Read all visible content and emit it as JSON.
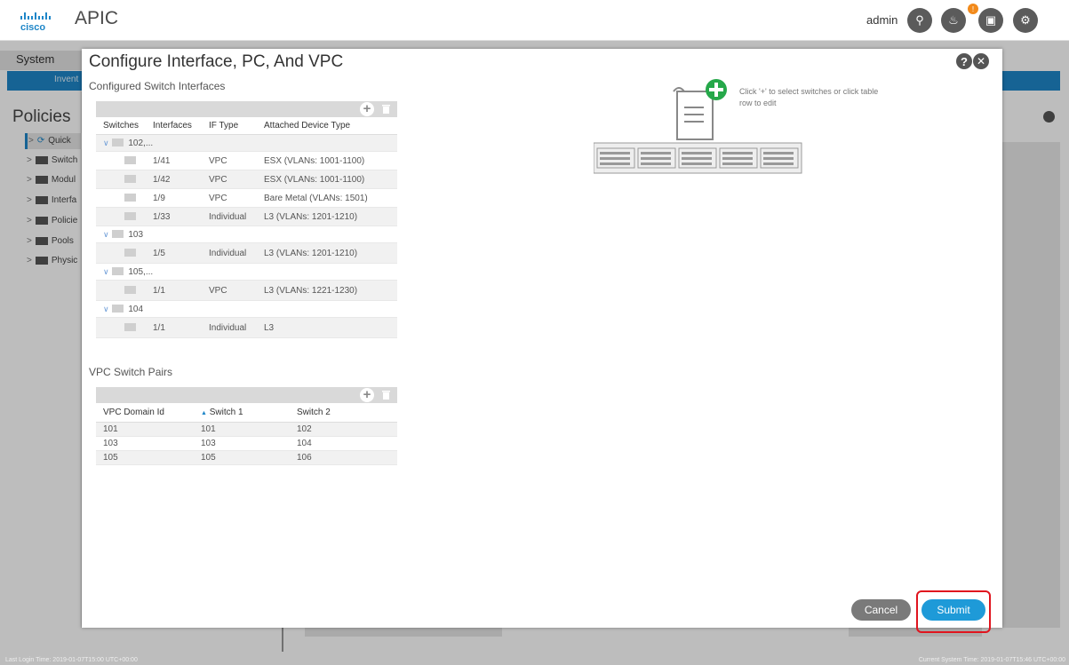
{
  "app": {
    "title": "APIC",
    "user": "admin"
  },
  "background": {
    "nav_system": "System",
    "nav_tab": "Invent",
    "policies_title": "Policies",
    "tree": [
      {
        "label": "Quick",
        "icon": "quick-start-icon"
      },
      {
        "label": "Switch",
        "icon": "folder-icon"
      },
      {
        "label": "Modul",
        "icon": "folder-icon"
      },
      {
        "label": "Interfa",
        "icon": "folder-icon"
      },
      {
        "label": "Policie",
        "icon": "folder-icon"
      },
      {
        "label": "Pools",
        "icon": "folder-icon"
      },
      {
        "label": "Physic",
        "icon": "folder-icon"
      }
    ],
    "status_left": "Last Login Time: 2019-01-07T15:00 UTC+00:00",
    "status_right": "Current System Time: 2019-01-07T15:46 UTC+00:00"
  },
  "modal": {
    "title": "Configure Interface, PC, And VPC",
    "configured_label": "Configured Switch Interfaces",
    "interfaces_table": {
      "headers": [
        "Switches",
        "Interfaces",
        "IF Type",
        "Attached Device Type"
      ],
      "rows": [
        {
          "kind": "group",
          "label": "102,..."
        },
        {
          "kind": "item",
          "interface": "1/41",
          "if_type": "VPC",
          "device": "ESX (VLANs: 1001-1100)"
        },
        {
          "kind": "item",
          "interface": "1/42",
          "if_type": "VPC",
          "device": "ESX (VLANs: 1001-1100)"
        },
        {
          "kind": "item",
          "interface": "1/9",
          "if_type": "VPC",
          "device": "Bare Metal (VLANs: 1501)"
        },
        {
          "kind": "item",
          "interface": "1/33",
          "if_type": "Individual",
          "device": "L3 (VLANs: 1201-1210)"
        },
        {
          "kind": "group",
          "label": "103"
        },
        {
          "kind": "item",
          "interface": "1/5",
          "if_type": "Individual",
          "device": "L3 (VLANs: 1201-1210)"
        },
        {
          "kind": "group",
          "label": "105,..."
        },
        {
          "kind": "item",
          "interface": "1/1",
          "if_type": "VPC",
          "device": "L3 (VLANs: 1221-1230)"
        },
        {
          "kind": "group",
          "label": "104"
        },
        {
          "kind": "item",
          "interface": "1/1",
          "if_type": "Individual",
          "device": "L3"
        }
      ]
    },
    "vpc_label": "VPC Switch Pairs",
    "vpc_table": {
      "headers": [
        "VPC Domain Id",
        "Switch 1",
        "Switch 2"
      ],
      "rows": [
        [
          "101",
          "101",
          "102"
        ],
        [
          "103",
          "103",
          "104"
        ],
        [
          "105",
          "105",
          "106"
        ]
      ]
    },
    "hint": "Click '+' to select switches or click table row to edit",
    "cancel_label": "Cancel",
    "submit_label": "Submit"
  },
  "colors": {
    "accent": "#1e86c8",
    "submit": "#1e9ad8",
    "highlight": "#e0141e",
    "add_green": "#26a84a"
  }
}
